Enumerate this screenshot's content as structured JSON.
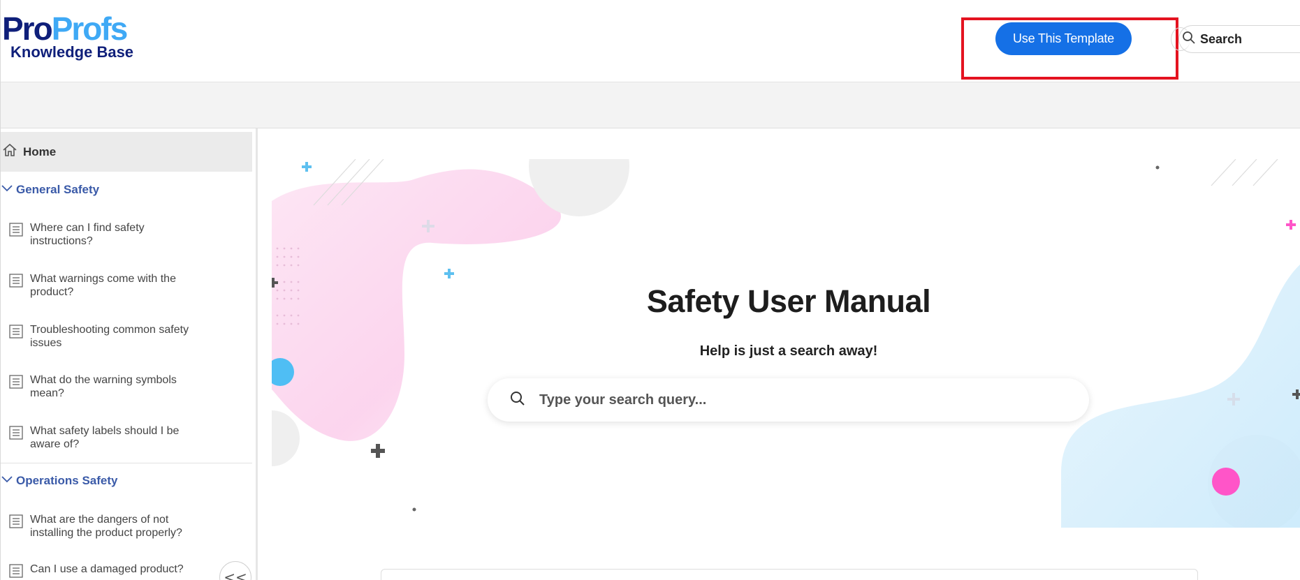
{
  "header": {
    "logo": {
      "brand_a": "Pro",
      "brand_b": "Profs",
      "subtitle": "Knowledge Base"
    },
    "use_template_label": "Use This Template",
    "search_label": "Search"
  },
  "sidebar": {
    "home_label": "Home",
    "sections": [
      {
        "title": "General Safety",
        "articles": [
          "Where can I find safety instructions?",
          "What warnings come with the product?",
          "Troubleshooting common safety issues",
          "What do the warning symbols mean?",
          "What safety labels should I be aware of?"
        ]
      },
      {
        "title": "Operations Safety",
        "articles": [
          "What are the dangers of not installing the product properly?",
          "Can I use a damaged product?"
        ]
      }
    ],
    "collapse_label": "<<"
  },
  "hero": {
    "title": "Safety User Manual",
    "subtitle": "Help is just a search away!",
    "search_placeholder": "Type your search query..."
  },
  "colors": {
    "primary_button": "#1570e6",
    "highlight_border": "#e41320",
    "section_title": "#3a5aa8",
    "logo_dark": "#0f1f7a",
    "logo_light": "#3fa9f5"
  }
}
